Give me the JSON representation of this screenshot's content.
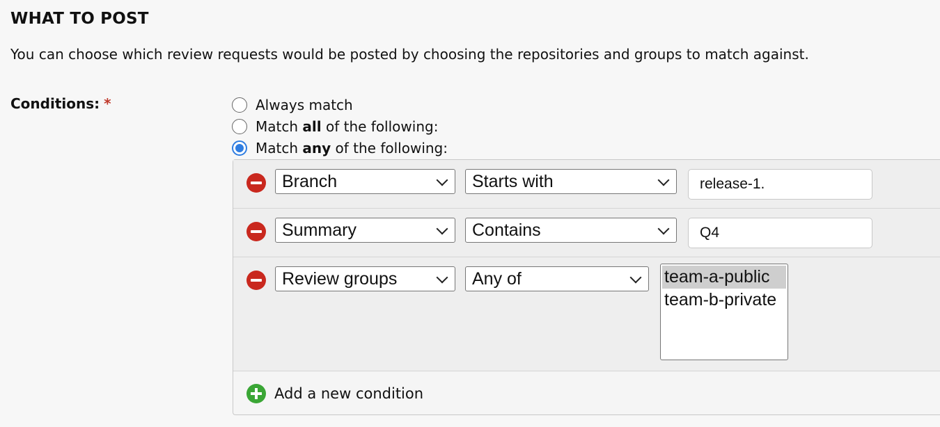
{
  "section": {
    "title": "WHAT TO POST",
    "description": "You can choose which review requests would be posted by choosing the repositories and groups to match against."
  },
  "conditions": {
    "label": "Conditions:",
    "required_marker": "*",
    "modes": [
      {
        "before": "Always match",
        "bold": "",
        "after": "",
        "checked": false
      },
      {
        "before": "Match ",
        "bold": "all",
        "after": " of the following:",
        "checked": false
      },
      {
        "before": "Match ",
        "bold": "any",
        "after": " of the following:",
        "checked": true
      }
    ],
    "rows": [
      {
        "field": "Branch",
        "operator": "Starts with",
        "value": "release-1."
      },
      {
        "field": "Summary",
        "operator": "Contains",
        "value": "Q4"
      },
      {
        "field": "Review groups",
        "operator": "Any of",
        "options": [
          {
            "label": "team-a-public",
            "selected": true
          },
          {
            "label": "team-b-private",
            "selected": false
          }
        ]
      }
    ],
    "add_label": "Add a new condition"
  },
  "colors": {
    "remove_icon": "#c9281e",
    "add_icon": "#3aa635",
    "radio_accent": "#2f7de1",
    "required_marker": "#c0392b"
  },
  "icons": {
    "remove": "minus-circle-icon",
    "add": "plus-circle-icon",
    "dropdown": "chevron-down-icon"
  }
}
